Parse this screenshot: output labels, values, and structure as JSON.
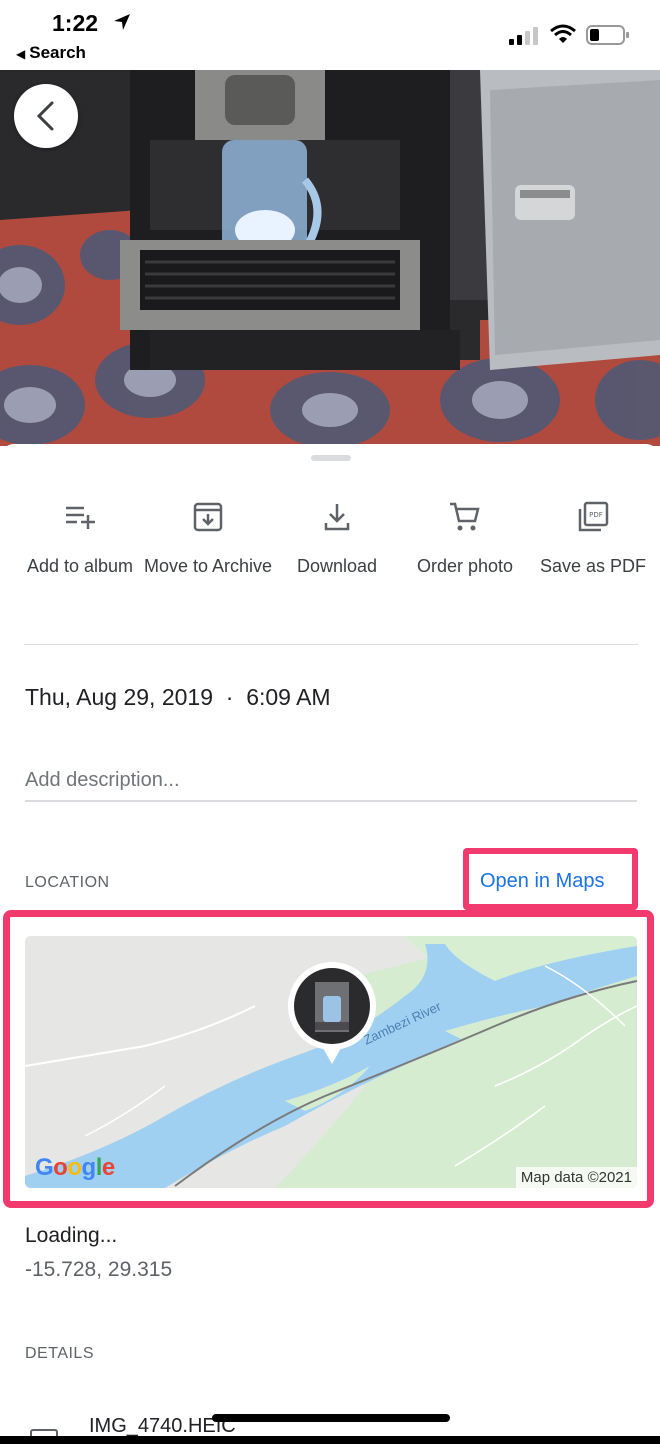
{
  "status_bar": {
    "time": "1:22",
    "back_app": "Search"
  },
  "actions": [
    {
      "label": "Add to album",
      "icon": "add-to-playlist-icon"
    },
    {
      "label": "Move to Archive",
      "icon": "archive-icon"
    },
    {
      "label": "Download",
      "icon": "download-icon"
    },
    {
      "label": "Order photo",
      "icon": "cart-icon"
    },
    {
      "label": "Save as PDF",
      "icon": "pdf-icon"
    }
  ],
  "info": {
    "datetime": "Thu, Aug 29, 2019  ·  6:09 AM",
    "description_placeholder": "Add description..."
  },
  "location": {
    "label": "LOCATION",
    "open_maps": "Open in Maps",
    "map_credit": "Map data ©2021",
    "river_label": "Zambezi River",
    "logo": "Google",
    "status": "Loading...",
    "coordinates": "-15.728, 29.315"
  },
  "details": {
    "label": "DETAILS",
    "file_name": "IMG_4740.HEIC"
  },
  "colors": {
    "accent": "#1a73e8",
    "highlight": "#f23a6f"
  }
}
